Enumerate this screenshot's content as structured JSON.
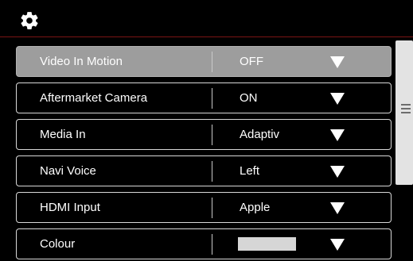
{
  "header": {
    "icon": "gear-icon"
  },
  "settings": [
    {
      "label": "Video In Motion",
      "value": "OFF",
      "selected": true
    },
    {
      "label": "Aftermarket Camera",
      "value": "ON"
    },
    {
      "label": "Media In",
      "value": "Adaptiv"
    },
    {
      "label": "Navi Voice",
      "value": "Left"
    },
    {
      "label": "HDMI Input",
      "value": "Apple"
    },
    {
      "label": "Colour",
      "value": "",
      "swatch": "#d6d6d6"
    }
  ],
  "colors": {
    "accent_line": "#7a1414",
    "selected_row": "#9d9d9d"
  }
}
